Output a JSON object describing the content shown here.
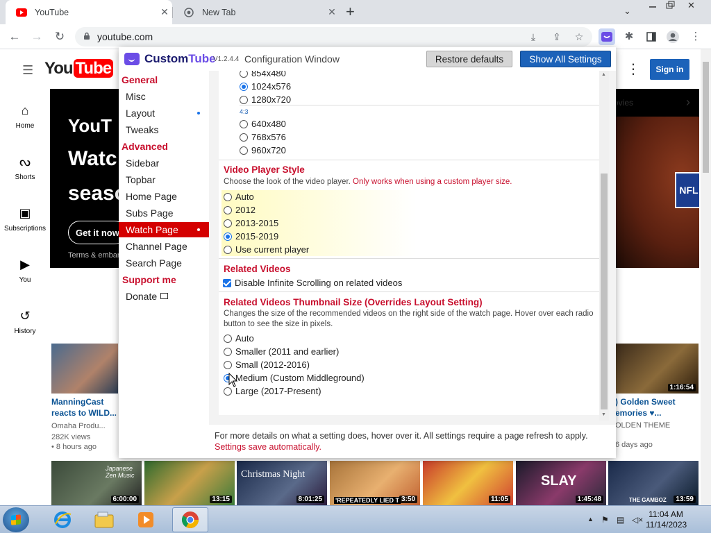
{
  "browser": {
    "tabs": [
      {
        "title": "YouTube",
        "active": true
      },
      {
        "title": "New Tab",
        "active": false
      }
    ],
    "url": "youtube.com"
  },
  "youtube": {
    "sign_in": "Sign in",
    "guide": [
      {
        "label": "Home",
        "icon": "home-icon"
      },
      {
        "label": "Shorts",
        "icon": "shorts-icon"
      },
      {
        "label": "Subscriptions",
        "icon": "subscriptions-icon"
      },
      {
        "label": "You",
        "icon": "library-icon"
      },
      {
        "label": "History",
        "icon": "history-icon"
      }
    ],
    "banner": {
      "line1": "YouT",
      "line2": "Watc",
      "line3": "seaso",
      "cta": "Get it now",
      "terms": "Terms & embar",
      "chip": "ovies"
    },
    "videos_row1": [
      {
        "title": "ManningCast reacts to WILD...",
        "channel": "Omaha Produ...",
        "views": "282K views",
        "age": "• 8 hours ago"
      },
      {
        "title": ") Golden Sweet emories ♥...",
        "channel": "OLDEN THEME",
        "views": "",
        "age": "6 days ago",
        "duration": "1:16:54"
      }
    ],
    "videos_row2": [
      {
        "duration": "6:00:00",
        "caption": "Japanese Zen Music"
      },
      {
        "duration": "13:15",
        "caption": ""
      },
      {
        "duration": "8:01:25",
        "caption": "Christmas Night"
      },
      {
        "duration": "3:50",
        "caption": "'REPEATEDLY LIED T"
      },
      {
        "duration": "11:05",
        "caption": ""
      },
      {
        "duration": "1:45:48",
        "caption": "SLAY"
      },
      {
        "duration": "13:59",
        "caption": "THE GAMBOZ"
      }
    ]
  },
  "customtube": {
    "name_a": "Custom",
    "name_b": "Tube",
    "version": "V1.2.4.4",
    "window_title": "Configuration Window",
    "restore_defaults": "Restore defaults",
    "show_all": "Show All Settings",
    "nav": {
      "general": "General",
      "misc": "Misc",
      "layout": "Layout",
      "tweaks": "Tweaks",
      "advanced": "Advanced",
      "sidebar": "Sidebar",
      "topbar": "Topbar",
      "home_page": "Home Page",
      "subs_page": "Subs Page",
      "watch_page": "Watch Page",
      "channel_page": "Channel Page",
      "search_page": "Search Page",
      "support": "Support me",
      "donate": "Donate"
    },
    "sizes_169": [
      {
        "label": "854x480",
        "checked": false
      },
      {
        "label": "1024x576",
        "checked": true
      },
      {
        "label": "1280x720",
        "checked": false
      }
    ],
    "ratio_43_label": "4:3",
    "sizes_43": [
      {
        "label": "640x480",
        "checked": false
      },
      {
        "label": "768x576",
        "checked": false
      },
      {
        "label": "960x720",
        "checked": false
      }
    ],
    "player_style": {
      "title": "Video Player Style",
      "desc": "Choose the look of the video player.",
      "warn": "Only works when using a custom player size.",
      "options": [
        {
          "label": "Auto",
          "checked": false
        },
        {
          "label": "2012",
          "checked": false
        },
        {
          "label": "2013-2015",
          "checked": false
        },
        {
          "label": "2015-2019",
          "checked": true
        },
        {
          "label": "Use current player",
          "checked": false
        }
      ]
    },
    "related": {
      "title": "Related Videos",
      "checkbox": "Disable Infinite Scrolling on related videos",
      "checked": true
    },
    "thumb_size": {
      "title": "Related Videos Thumbnail Size (Overrides Layout Setting)",
      "desc": "Changes the size of the recommended videos on the right side of the watch page. Hover over each radio button to see the size in pixels.",
      "options": [
        {
          "label": "Auto",
          "checked": false
        },
        {
          "label": "Smaller (2011 and earlier)",
          "checked": false
        },
        {
          "label": "Small (2012-2016)",
          "checked": false
        },
        {
          "label": "Medium (Custom Middleground)",
          "checked": true
        },
        {
          "label": "Large (2017-Present)",
          "checked": false
        }
      ]
    },
    "footer_line1": "For more details on what a setting does, hover over it. All settings require a page refresh to apply.",
    "footer_line2": "Settings save automatically."
  },
  "taskbar": {
    "time": "11:04 AM",
    "date": "11/14/2023"
  },
  "colors": {
    "accent_red": "#c8102e",
    "nav_active": "#d40000",
    "button_blue": "#1c62b9",
    "radio_blue": "#1a73e8"
  }
}
